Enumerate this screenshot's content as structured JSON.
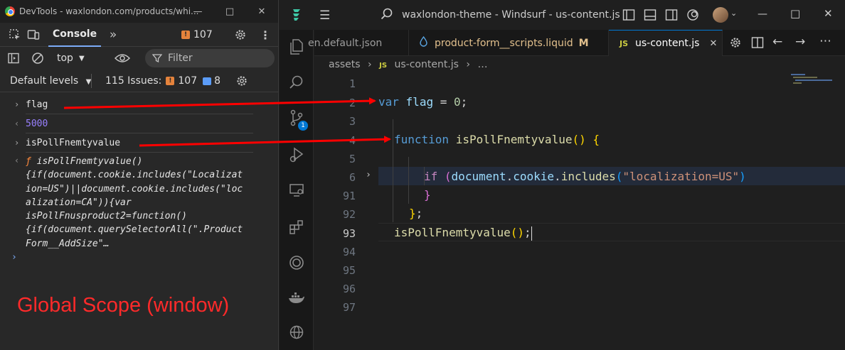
{
  "devtools": {
    "window_title": "DevTools - waxlondon.com/products/whi...",
    "console_tab": "Console",
    "issues_count": "107",
    "context": "top",
    "filter_label": "Filter",
    "levels_label": "Default levels",
    "issues_label": "115 Issues:",
    "issues_warn": "107",
    "issues_info": "8",
    "rows": {
      "flag": "flag",
      "result_5000": "5000",
      "fn_name": "isPollFnemtyvalue",
      "fn_line1": "ƒ",
      "fn_text": " isPollFnemtyvalue()\n{if(document.cookie.includes(\"Localizat\nion=US\")||document.cookie.includes(\"loc\nalization=CA\")){var\nisPollFnusproduct2=function()\n{if(document.querySelectorAll(\".Product\nForm__AddSize\"…"
    },
    "annotation": "Global Scope (window)"
  },
  "editor": {
    "window_title": "waxlondon-theme - Windsurf - us-content.js",
    "tabs": [
      {
        "label": "en.default.json"
      },
      {
        "label": "product-form__scripts.liquid",
        "modified": "M"
      },
      {
        "label": "us-content.js",
        "badge": "JS"
      }
    ],
    "breadcrumb": {
      "folder": "assets",
      "badge": "JS",
      "file": "us-content.js",
      "rest": "…"
    },
    "line_numbers": [
      "1",
      "2",
      "3",
      "4",
      "5",
      "6",
      "91",
      "92",
      "93",
      "94",
      "95",
      "96",
      "97"
    ],
    "code": {
      "l2_kw": "var",
      "l2_var": "flag",
      "l2_op": " = ",
      "l2_num": "0",
      "l2_end": ";",
      "l4_kw": "function",
      "l4_fn": "isPollFnemtyvalue",
      "l4_p1": "()",
      "l4_b": "{",
      "l6_kw": "if",
      "l6_p1": "(",
      "l6_obj": "document",
      "l6_dot": ".",
      "l6_prop": "cookie",
      "l6_dot2": ".",
      "l6_fn": "includes",
      "l6_p2": "(",
      "l6_str": "\"localization=US\"",
      "l6_p3": ")",
      "l91": "}",
      "l92_b": "}",
      "l92_end": ";",
      "l93_fn": "isPollFnemtyvalue",
      "l93_p": "()",
      "l93_end": ";"
    },
    "scm_badge": "1"
  },
  "colors": {
    "annotation_red": "#ff0000",
    "accent_blue": "#0078d4"
  }
}
